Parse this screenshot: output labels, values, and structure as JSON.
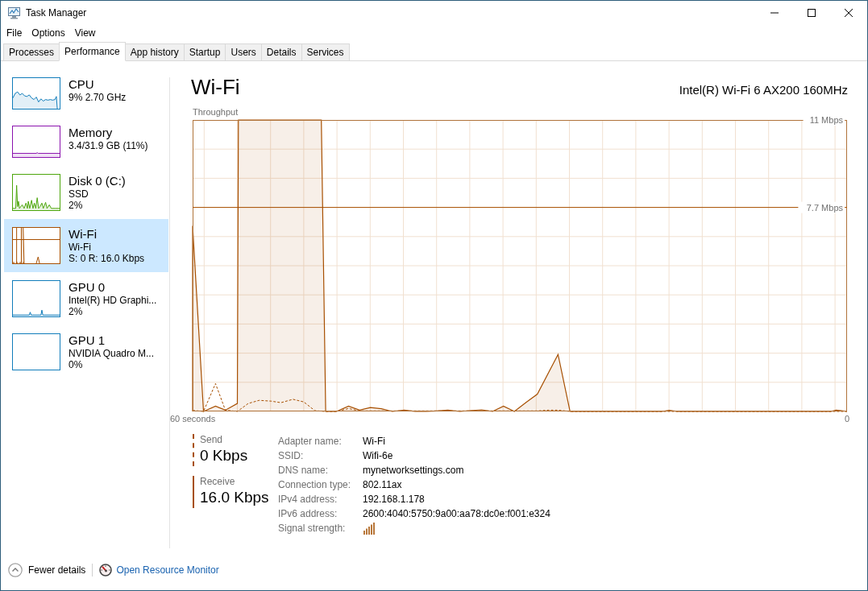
{
  "window": {
    "title": "Task Manager"
  },
  "menu": [
    {
      "label": "File"
    },
    {
      "label": "Options"
    },
    {
      "label": "View"
    }
  ],
  "tabs": [
    {
      "label": "Processes",
      "selected": false
    },
    {
      "label": "Performance",
      "selected": true
    },
    {
      "label": "App history",
      "selected": false
    },
    {
      "label": "Startup",
      "selected": false
    },
    {
      "label": "Users",
      "selected": false
    },
    {
      "label": "Details",
      "selected": false
    },
    {
      "label": "Services",
      "selected": false
    }
  ],
  "sidebar": {
    "items": [
      {
        "title": "CPU",
        "lines": [
          "9% 2.70 GHz"
        ],
        "color": "#117dbb",
        "selected": false
      },
      {
        "title": "Memory",
        "lines": [
          "3.4/31.9 GB (11%)"
        ],
        "color": "#8b12ae",
        "selected": false
      },
      {
        "title": "Disk 0 (C:)",
        "lines": [
          "SSD",
          "2%"
        ],
        "color": "#4da60c",
        "selected": false
      },
      {
        "title": "Wi-Fi",
        "lines": [
          "Wi-Fi",
          "S: 0 R: 16.0 Kbps"
        ],
        "color": "#a74f01",
        "selected": true
      },
      {
        "title": "GPU 0",
        "lines": [
          "Intel(R) HD Graphi...",
          "2%"
        ],
        "color": "#117dbb",
        "selected": false
      },
      {
        "title": "GPU 1",
        "lines": [
          "NVIDIA Quadro M...",
          "0%"
        ],
        "color": "#117dbb",
        "selected": false
      }
    ]
  },
  "detail": {
    "title": "Wi-Fi",
    "adapter": "Intel(R) Wi-Fi 6 AX200 160MHz",
    "chart_data": [
      {
        "type": "line",
        "title": "Throughput",
        "xlim": [
          60,
          0
        ],
        "ylim": [
          0,
          11
        ],
        "xticks": [
          {
            "value": 60,
            "label": "60 seconds"
          },
          {
            "value": 0,
            "label": "0"
          }
        ],
        "yticks": [
          {
            "value": 7.7,
            "label": "7.7 Mbps"
          },
          {
            "value": 11,
            "label": "11 Mbps"
          }
        ],
        "grid": true,
        "ref_lines": [
          {
            "axis": "y",
            "value": 7.7,
            "color": "#a74f01",
            "line_style": "solid"
          }
        ],
        "series": [
          {
            "type": "area",
            "color": "#a74f01",
            "line_style": "solid",
            "x": [
              60,
              59,
              57.9,
              57,
              55.9,
              55.8,
              48.2,
              47.8,
              46.8,
              45.7,
              44.7,
              43.7,
              42.7,
              41.7,
              40.6,
              39.6,
              38.6,
              37.6,
              36.6,
              35.5,
              34.6,
              33.5,
              32.5,
              31.5,
              30.5,
              29.4,
              28.4,
              26.5,
              25.4,
              17,
              16.3,
              15.5,
              1.5,
              1,
              0.5,
              0
            ],
            "values": [
              7,
              0,
              0.2,
              0.05,
              0.3,
              11,
              11,
              0,
              0,
              0.2,
              0.05,
              0.15,
              0.1,
              0,
              0.05,
              0,
              0,
              0.02,
              0.05,
              0,
              0.03,
              0.06,
              0,
              0.2,
              0,
              0.35,
              0.65,
              2.15,
              0,
              0,
              0.04,
              0,
              0,
              0.05,
              0.03,
              0
            ]
          },
          {
            "type": "line",
            "color": "#a74f01",
            "line_style": "dashed",
            "x": [
              60,
              59,
              57.9,
              57,
              55.9,
              54.9,
              53.9,
              52.8,
              51.9,
              50.8,
              49.8,
              48.8,
              47.9,
              46.8,
              45.7,
              44.7,
              28.4,
              27.4,
              26.5,
              25.4,
              0
            ],
            "values": [
              0.04,
              0,
              1.05,
              0.05,
              0,
              0.3,
              0.42,
              0.39,
              0.33,
              0.46,
              0.36,
              0.03,
              0,
              0,
              0.11,
              0.02,
              0.02,
              0.05,
              0.05,
              0,
              0
            ]
          }
        ]
      }
    ],
    "stats": [
      {
        "kind": "dashed",
        "label": "Send",
        "value": "0 Kbps"
      },
      {
        "kind": "solid",
        "label": "Receive",
        "value": "16.0 Kbps"
      }
    ],
    "properties": [
      {
        "kind": "text",
        "label": "Adapter name:",
        "value": "Wi-Fi"
      },
      {
        "kind": "text",
        "label": "SSID:",
        "value": "Wifi-6e"
      },
      {
        "kind": "text",
        "label": "DNS name:",
        "value": "mynetworksettings.com"
      },
      {
        "kind": "text",
        "label": "Connection type:",
        "value": "802.11ax"
      },
      {
        "kind": "text",
        "label": "IPv4 address:",
        "value": "192.168.1.178"
      },
      {
        "kind": "text",
        "label": "IPv6 address:",
        "value": "2600:4040:5750:9a00:aa78:dc0e:f001:e324"
      },
      {
        "kind": "signal",
        "label": "Signal strength:"
      }
    ]
  },
  "footer": {
    "toggle": "Fewer details",
    "link": "Open Resource Monitor"
  }
}
